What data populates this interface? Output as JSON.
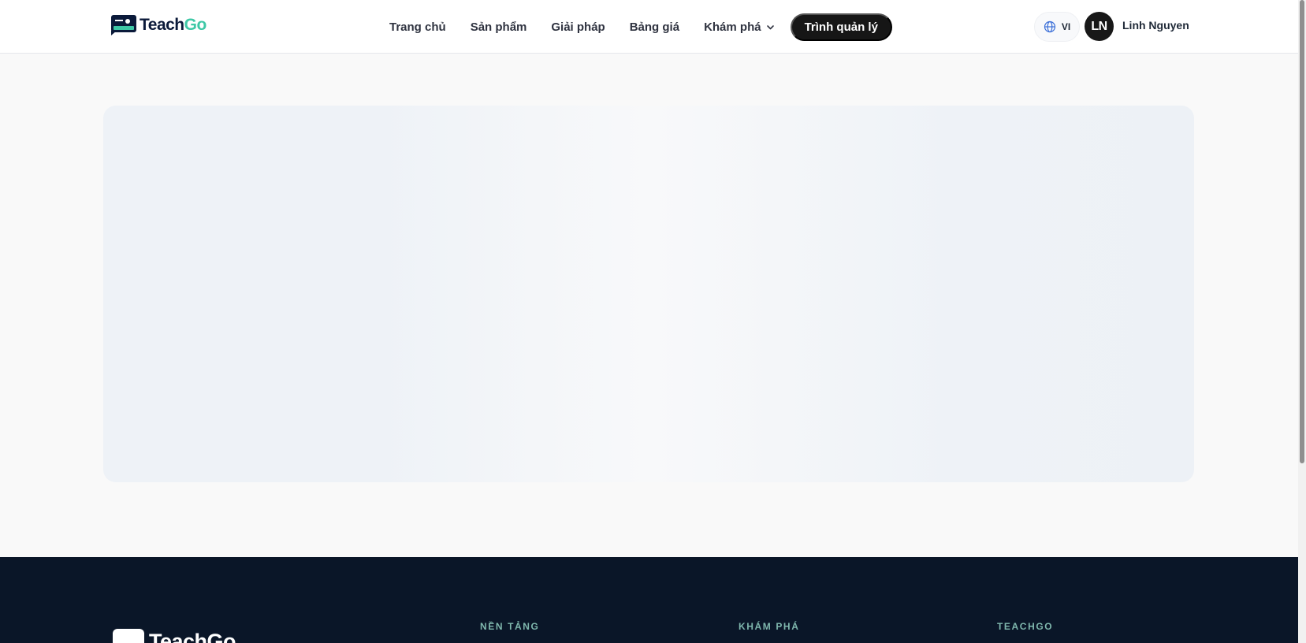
{
  "header": {
    "brand": {
      "teach": "Teach",
      "go": "Go"
    },
    "nav": [
      {
        "label": "Trang chủ"
      },
      {
        "label": "Sản phẩm"
      },
      {
        "label": "Giải pháp"
      },
      {
        "label": "Bảng giá"
      },
      {
        "label": "Khám phá",
        "has_dropdown": true
      }
    ],
    "cta_label": "Trình quản lý",
    "language": {
      "code": "VI",
      "icon": "globe-icon"
    },
    "user": {
      "initials": "LN",
      "name": "Linh Nguyen"
    }
  },
  "main": {
    "state": "loading"
  },
  "footer": {
    "brand": "TeachGo",
    "columns": [
      {
        "heading": "NỀN TẢNG"
      },
      {
        "heading": "KHÁM PHÁ"
      },
      {
        "heading": "TEACHGO"
      }
    ]
  },
  "colors": {
    "brand_navy": "#0b1a3a",
    "brand_green": "#3ec8a6",
    "footer_bg": "#0a1628",
    "footer_heading": "#7fb7ad",
    "cta_bg": "#161616"
  }
}
